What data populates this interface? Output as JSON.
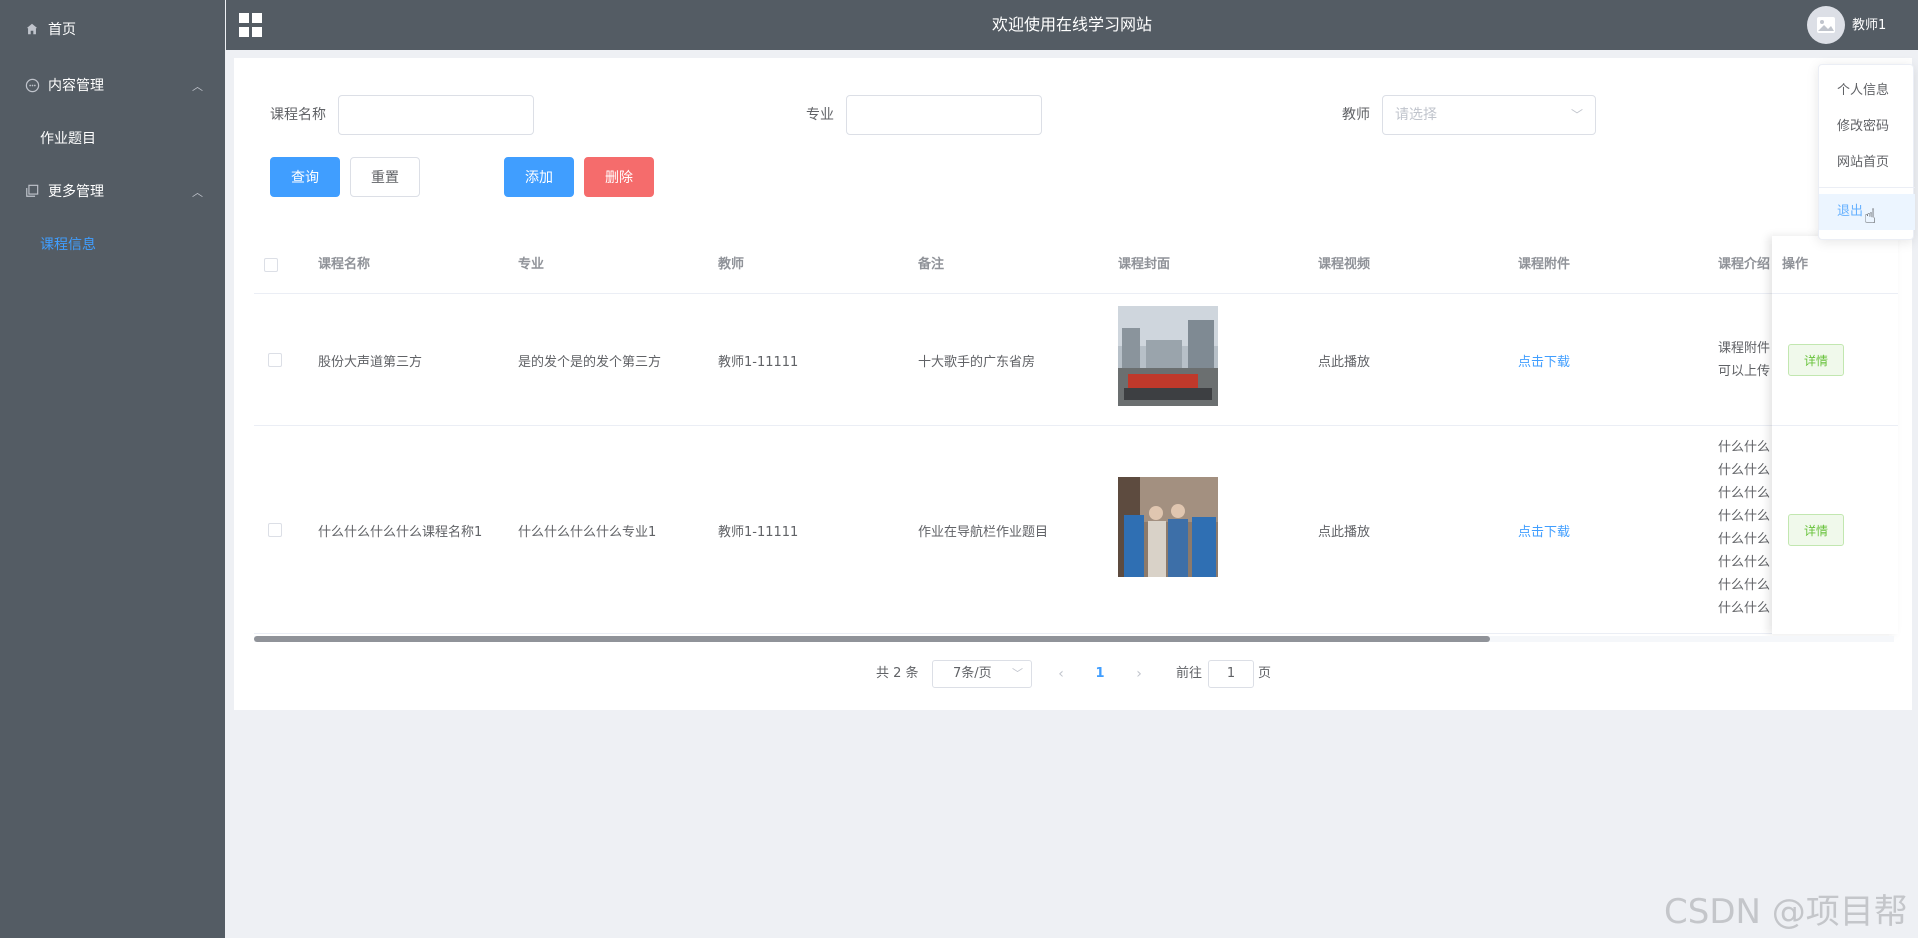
{
  "header": {
    "title": "欢迎使用在线学习网站",
    "username": "教师1"
  },
  "sidebar": {
    "items": [
      {
        "label": "首页"
      },
      {
        "label": "内容管理"
      },
      {
        "label": "作业题目"
      },
      {
        "label": "更多管理"
      },
      {
        "label": "课程信息"
      }
    ]
  },
  "search": {
    "course_name_label": "课程名称",
    "major_label": "专业",
    "teacher_label": "教师",
    "teacher_placeholder": "请选择",
    "query_button": "查询",
    "reset_button": "重置",
    "add_button": "添加",
    "delete_button": "删除"
  },
  "table": {
    "columns": [
      "课程名称",
      "专业",
      "教师",
      "备注",
      "课程封面",
      "课程视频",
      "课程附件",
      "课程介绍",
      "操作"
    ],
    "rows": [
      {
        "course_name": "股份大声道第三方",
        "major": "是的发个是的发个第三方",
        "teacher": "教师1-11111",
        "remark": "十大歌手的广东省房",
        "video": "点此播放",
        "attachment": "点击下载",
        "intro_lines": [
          "课程附件",
          "可以上传"
        ],
        "action": "详情"
      },
      {
        "course_name": "什么什么什么什么课程名称1",
        "major": "什么什么什么什么专业1",
        "teacher": "教师1-11111",
        "remark": "作业在导航栏作业题目",
        "video": "点此播放",
        "attachment": "点击下载",
        "intro_lines": [
          "什么什么",
          "什么什么",
          "什么什么",
          "什么什么",
          "什么什么",
          "什么什么",
          "什么什么",
          "什么什么"
        ],
        "action": "详情"
      }
    ]
  },
  "pagination": {
    "total": "共 2 条",
    "page_size": "7条/页",
    "current_page": "1",
    "goto_label": "前往",
    "goto_value": "1",
    "page_suffix": "页"
  },
  "user_menu": {
    "items": [
      "个人信息",
      "修改密码",
      "网站首页",
      "退出"
    ]
  },
  "watermark": "CSDN @项目帮",
  "colors": {
    "sidebar": "#545c64",
    "primary": "#409eff",
    "danger": "#f56c6c",
    "success": "#67c23a"
  }
}
